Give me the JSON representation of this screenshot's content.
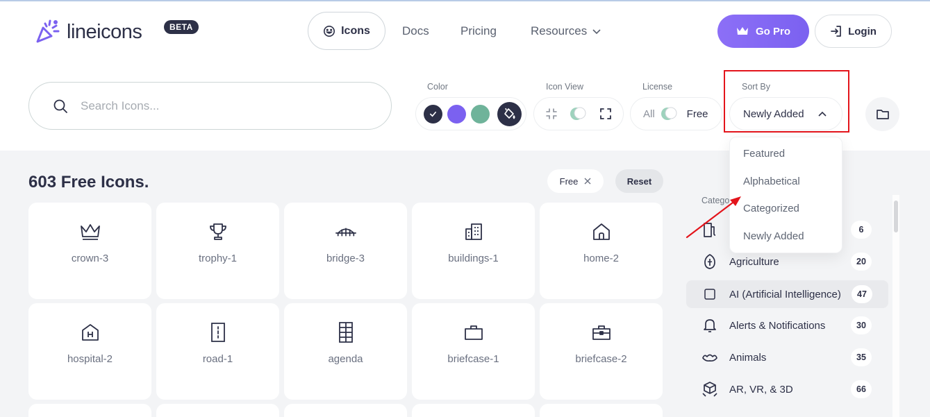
{
  "brand": {
    "name": "lineicons",
    "badge": "BETA"
  },
  "nav": {
    "icons": "Icons",
    "docs": "Docs",
    "pricing": "Pricing",
    "resources": "Resources"
  },
  "actions": {
    "gopro": "Go Pro",
    "login": "Login"
  },
  "search": {
    "placeholder": "Search Icons...",
    "value": ""
  },
  "filters": {
    "color_label": "Color",
    "colors": [
      "#2d3047",
      "#7b61f0",
      "#6fb39a"
    ],
    "iconview_label": "Icon View",
    "license_label": "License",
    "license_all": "All",
    "license_free": "Free",
    "sortby_label": "Sort By",
    "sortby_value": "Newly Added"
  },
  "sort_options": [
    "Featured",
    "Alphabetical",
    "Categorized",
    "Newly Added"
  ],
  "results": {
    "count_title": "603 Free Icons.",
    "chip": "Free",
    "reset": "Reset"
  },
  "icons": [
    {
      "name": "crown-3",
      "icon": "crown-icon"
    },
    {
      "name": "trophy-1",
      "icon": "trophy-icon"
    },
    {
      "name": "bridge-3",
      "icon": "bridge-icon"
    },
    {
      "name": "buildings-1",
      "icon": "buildings-icon"
    },
    {
      "name": "home-2",
      "icon": "home-icon"
    },
    {
      "name": "hospital-2",
      "icon": "hospital-icon"
    },
    {
      "name": "road-1",
      "icon": "road-icon"
    },
    {
      "name": "agenda",
      "icon": "agenda-icon"
    },
    {
      "name": "briefcase-1",
      "icon": "briefcase-icon"
    },
    {
      "name": "briefcase-2",
      "icon": "briefcase-2-icon"
    }
  ],
  "categories": {
    "title": "Catego",
    "items": [
      {
        "label": "",
        "count": "6",
        "icon": "fuel-icon"
      },
      {
        "label": "Agriculture",
        "count": "20",
        "icon": "agriculture-icon"
      },
      {
        "label": "AI (Artificial Intelligence)",
        "count": "47",
        "icon": "ai-icon"
      },
      {
        "label": "Alerts & Notifications",
        "count": "30",
        "icon": "alarm-icon"
      },
      {
        "label": "Animals",
        "count": "35",
        "icon": "animals-icon"
      },
      {
        "label": "AR, VR, & 3D",
        "count": "66",
        "icon": "ar-vr-icon"
      }
    ]
  }
}
